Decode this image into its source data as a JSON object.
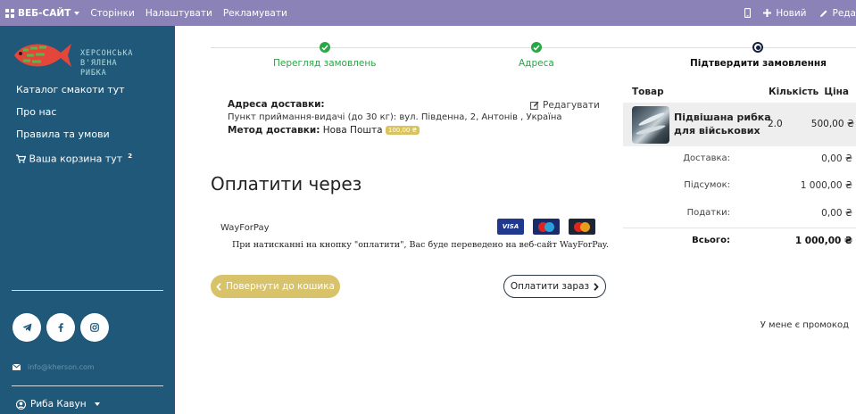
{
  "topbar": {
    "site_label": "ВЕБ-САЙТ",
    "pages_label": "Сторінки",
    "settings_label": "Налаштувати",
    "ads_label": "Рекламувати",
    "new_label": "Новий",
    "edit_label": "Реда"
  },
  "sidebar": {
    "logo_lines": [
      "ХЕРСОНСЬКА",
      "В'ЯЛЕНА",
      "РИБКА"
    ],
    "nav": [
      {
        "label": "Каталог смакоти тут"
      },
      {
        "label": "Про нас"
      },
      {
        "label": "Правила та умови"
      },
      {
        "label": "Ваша корзина тут",
        "count": "2"
      }
    ],
    "email": "info@kherson.com",
    "user_name": "Риба Кавун"
  },
  "steps": [
    {
      "label": "Перегляд замовлень",
      "state": "done"
    },
    {
      "label": "Адреса",
      "state": "done"
    },
    {
      "label": "Підтвердити замовлення",
      "state": "current"
    }
  ],
  "address": {
    "heading": "Адреса доставки:",
    "value": "Пункт приймання-видачі (до 30 кг): вул. Південна, 2, Антонів , Україна",
    "edit_label": "Редагувати",
    "delivery_method_label": "Метод доставки:",
    "delivery_method_value": "Нова Пошта",
    "delivery_price_badge": "100,00 ₴"
  },
  "payment": {
    "title": "Оплатити через",
    "provider": "WayForPay",
    "cards": [
      "VISA",
      "maestro",
      "MasterCard"
    ],
    "notice": "При натисканні на кнопку \"оплатити\", Вас буде переведено на веб-сайт WayForPay."
  },
  "buttons": {
    "back_label": "Повернути до кошика",
    "pay_label": "Оплатити зараз"
  },
  "summary": {
    "headers": {
      "product": "Товар",
      "qty": "Кількість",
      "price": "Ціна"
    },
    "product": {
      "name_line1": "Підвішана рибка",
      "name_line2": "для військових",
      "qty": "2.0",
      "price": "500,00 ₴"
    },
    "rows": [
      {
        "label": "Доставка:",
        "value": "0,00 ₴"
      },
      {
        "label": "Підсумок:",
        "value": "1 000,00 ₴"
      },
      {
        "label": "Податки:",
        "value": "0,00 ₴"
      },
      {
        "label": "Всього:",
        "value": "1 000,00 ₴"
      }
    ],
    "promo_label": "У мене є промокод"
  },
  "colors": {
    "topbar": "#8b82b8",
    "sidebar": "#1f5878",
    "success": "#28a745",
    "accent_gold": "#d8c36a"
  }
}
